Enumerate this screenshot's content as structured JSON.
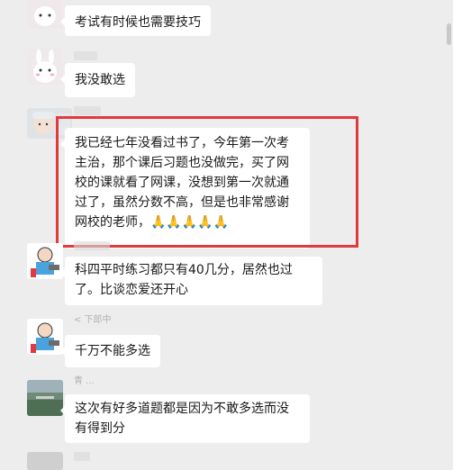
{
  "messages": [
    {
      "id": "m1",
      "sender": "",
      "text": "考试有时候也需要技巧"
    },
    {
      "id": "m2",
      "sender": "",
      "text": "我没敢选"
    },
    {
      "id": "m3",
      "sender": "",
      "text": "我已经七年没看过书了，今年第一次考主治，那个课后习题也没做完，买了网校的课就看了网课，没想到第一次就通过了，虽然分数不高，但是也非常感谢网校的老师，",
      "emoji": "🙏🙏🙏🙏🙏",
      "highlighted": true
    },
    {
      "id": "m4",
      "sender": "",
      "text": "科四平时练习都只有40几分，居然也过了。比谈恋爱还开心"
    },
    {
      "id": "m5",
      "sender": "< 下郎中",
      "text": "千万不能多选"
    },
    {
      "id": "m6",
      "sender": "青 ...",
      "text": "这次有好多道题都是因为不敢多选而没有得到分"
    }
  ],
  "colors": {
    "background": "#ededed",
    "bubble": "#ffffff",
    "highlight": "#e03a3e"
  },
  "icons": [
    "bunny-avatar-icon",
    "baby-avatar-icon",
    "cartoon-avatar-icon",
    "landscape-avatar-icon"
  ]
}
